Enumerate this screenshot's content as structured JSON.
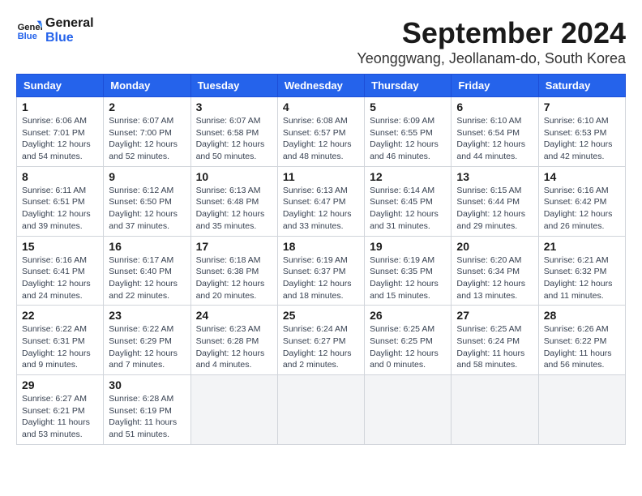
{
  "logo": {
    "line1": "General",
    "line2": "Blue"
  },
  "title": "September 2024",
  "location": "Yeonggwang, Jeollanam-do, South Korea",
  "days_of_week": [
    "Sunday",
    "Monday",
    "Tuesday",
    "Wednesday",
    "Thursday",
    "Friday",
    "Saturday"
  ],
  "weeks": [
    [
      {
        "num": "1",
        "info": "Sunrise: 6:06 AM\nSunset: 7:01 PM\nDaylight: 12 hours\nand 54 minutes."
      },
      {
        "num": "2",
        "info": "Sunrise: 6:07 AM\nSunset: 7:00 PM\nDaylight: 12 hours\nand 52 minutes."
      },
      {
        "num": "3",
        "info": "Sunrise: 6:07 AM\nSunset: 6:58 PM\nDaylight: 12 hours\nand 50 minutes."
      },
      {
        "num": "4",
        "info": "Sunrise: 6:08 AM\nSunset: 6:57 PM\nDaylight: 12 hours\nand 48 minutes."
      },
      {
        "num": "5",
        "info": "Sunrise: 6:09 AM\nSunset: 6:55 PM\nDaylight: 12 hours\nand 46 minutes."
      },
      {
        "num": "6",
        "info": "Sunrise: 6:10 AM\nSunset: 6:54 PM\nDaylight: 12 hours\nand 44 minutes."
      },
      {
        "num": "7",
        "info": "Sunrise: 6:10 AM\nSunset: 6:53 PM\nDaylight: 12 hours\nand 42 minutes."
      }
    ],
    [
      {
        "num": "8",
        "info": "Sunrise: 6:11 AM\nSunset: 6:51 PM\nDaylight: 12 hours\nand 39 minutes."
      },
      {
        "num": "9",
        "info": "Sunrise: 6:12 AM\nSunset: 6:50 PM\nDaylight: 12 hours\nand 37 minutes."
      },
      {
        "num": "10",
        "info": "Sunrise: 6:13 AM\nSunset: 6:48 PM\nDaylight: 12 hours\nand 35 minutes."
      },
      {
        "num": "11",
        "info": "Sunrise: 6:13 AM\nSunset: 6:47 PM\nDaylight: 12 hours\nand 33 minutes."
      },
      {
        "num": "12",
        "info": "Sunrise: 6:14 AM\nSunset: 6:45 PM\nDaylight: 12 hours\nand 31 minutes."
      },
      {
        "num": "13",
        "info": "Sunrise: 6:15 AM\nSunset: 6:44 PM\nDaylight: 12 hours\nand 29 minutes."
      },
      {
        "num": "14",
        "info": "Sunrise: 6:16 AM\nSunset: 6:42 PM\nDaylight: 12 hours\nand 26 minutes."
      }
    ],
    [
      {
        "num": "15",
        "info": "Sunrise: 6:16 AM\nSunset: 6:41 PM\nDaylight: 12 hours\nand 24 minutes."
      },
      {
        "num": "16",
        "info": "Sunrise: 6:17 AM\nSunset: 6:40 PM\nDaylight: 12 hours\nand 22 minutes."
      },
      {
        "num": "17",
        "info": "Sunrise: 6:18 AM\nSunset: 6:38 PM\nDaylight: 12 hours\nand 20 minutes."
      },
      {
        "num": "18",
        "info": "Sunrise: 6:19 AM\nSunset: 6:37 PM\nDaylight: 12 hours\nand 18 minutes."
      },
      {
        "num": "19",
        "info": "Sunrise: 6:19 AM\nSunset: 6:35 PM\nDaylight: 12 hours\nand 15 minutes."
      },
      {
        "num": "20",
        "info": "Sunrise: 6:20 AM\nSunset: 6:34 PM\nDaylight: 12 hours\nand 13 minutes."
      },
      {
        "num": "21",
        "info": "Sunrise: 6:21 AM\nSunset: 6:32 PM\nDaylight: 12 hours\nand 11 minutes."
      }
    ],
    [
      {
        "num": "22",
        "info": "Sunrise: 6:22 AM\nSunset: 6:31 PM\nDaylight: 12 hours\nand 9 minutes."
      },
      {
        "num": "23",
        "info": "Sunrise: 6:22 AM\nSunset: 6:29 PM\nDaylight: 12 hours\nand 7 minutes."
      },
      {
        "num": "24",
        "info": "Sunrise: 6:23 AM\nSunset: 6:28 PM\nDaylight: 12 hours\nand 4 minutes."
      },
      {
        "num": "25",
        "info": "Sunrise: 6:24 AM\nSunset: 6:27 PM\nDaylight: 12 hours\nand 2 minutes."
      },
      {
        "num": "26",
        "info": "Sunrise: 6:25 AM\nSunset: 6:25 PM\nDaylight: 12 hours\nand 0 minutes."
      },
      {
        "num": "27",
        "info": "Sunrise: 6:25 AM\nSunset: 6:24 PM\nDaylight: 11 hours\nand 58 minutes."
      },
      {
        "num": "28",
        "info": "Sunrise: 6:26 AM\nSunset: 6:22 PM\nDaylight: 11 hours\nand 56 minutes."
      }
    ],
    [
      {
        "num": "29",
        "info": "Sunrise: 6:27 AM\nSunset: 6:21 PM\nDaylight: 11 hours\nand 53 minutes."
      },
      {
        "num": "30",
        "info": "Sunrise: 6:28 AM\nSunset: 6:19 PM\nDaylight: 11 hours\nand 51 minutes."
      },
      {
        "num": "",
        "info": ""
      },
      {
        "num": "",
        "info": ""
      },
      {
        "num": "",
        "info": ""
      },
      {
        "num": "",
        "info": ""
      },
      {
        "num": "",
        "info": ""
      }
    ]
  ]
}
